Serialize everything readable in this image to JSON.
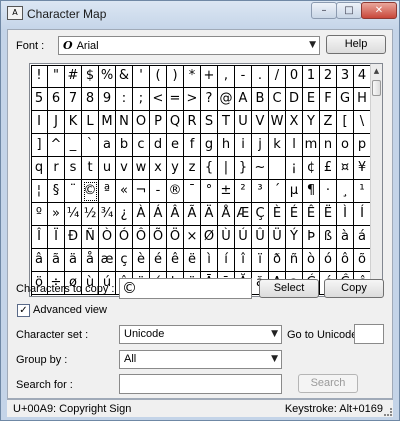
{
  "window": {
    "title": "Character Map",
    "controls": {
      "minimize": "–",
      "maximize": "□",
      "close": "✕"
    }
  },
  "font": {
    "label": "Font :",
    "value": "Arial",
    "font_glyph": "O",
    "help": "Help"
  },
  "grid": {
    "characters": [
      "!",
      "\"",
      "#",
      "$",
      "%",
      "&",
      "'",
      "(",
      ")",
      "*",
      "+",
      ",",
      "-",
      ".",
      "/",
      "0",
      "1",
      "2",
      "3",
      "4",
      "5",
      "6",
      "7",
      "8",
      "9",
      ":",
      ";",
      "<",
      "=",
      ">",
      "?",
      "@",
      "A",
      "B",
      "C",
      "D",
      "E",
      "F",
      "G",
      "H",
      "I",
      "J",
      "K",
      "L",
      "M",
      "N",
      "O",
      "P",
      "Q",
      "R",
      "S",
      "T",
      "U",
      "V",
      "W",
      "X",
      "Y",
      "Z",
      "[",
      "\\",
      "]",
      "^",
      "_",
      "`",
      "a",
      "b",
      "c",
      "d",
      "e",
      "f",
      "g",
      "h",
      "i",
      "j",
      "k",
      "l",
      "m",
      "n",
      "o",
      "p",
      "q",
      "r",
      "s",
      "t",
      "u",
      "v",
      "w",
      "x",
      "y",
      "z",
      "{",
      "|",
      "}",
      "~",
      " ",
      "¡",
      "¢",
      "£",
      "¤",
      "¥",
      "¦",
      "§",
      "¨",
      "©",
      "ª",
      "«",
      "¬",
      "-",
      "®",
      "¯",
      "°",
      "±",
      "²",
      "³",
      "´",
      "µ",
      "¶",
      "·",
      "¸",
      "¹",
      "º",
      "»",
      "¼",
      "½",
      "¾",
      "¿",
      "À",
      "Á",
      "Â",
      "Ã",
      "Ä",
      "Å",
      "Æ",
      "Ç",
      "È",
      "É",
      "Ê",
      "Ë",
      "Ì",
      "Í",
      "Î",
      "Ï",
      "Ð",
      "Ñ",
      "Ò",
      "Ó",
      "Ô",
      "Õ",
      "Ö",
      "×",
      "Ø",
      "Ù",
      "Ú",
      "Û",
      "Ü",
      "Ý",
      "Þ",
      "ß",
      "à",
      "á",
      "â",
      "ã",
      "ä",
      "å",
      "æ",
      "ç",
      "è",
      "é",
      "ê",
      "ë",
      "ì",
      "í",
      "î",
      "ï",
      "ð",
      "ñ",
      "ò",
      "ó",
      "ô",
      "õ",
      "ö",
      "÷",
      "ø",
      "ù",
      "ú",
      "û",
      "ü",
      "ý",
      "þ",
      "ÿ",
      "Ā",
      "ā",
      "Ă",
      "ă",
      "Ą",
      "ą",
      "Ć",
      "ć",
      "Ĉ",
      "ĉ"
    ],
    "selected_character": "©"
  },
  "copy": {
    "label": "Characters to copy :",
    "value": "©",
    "select": "Select",
    "copy": "Copy"
  },
  "advanced": {
    "label": "Advanced view",
    "checked_mark": "✓"
  },
  "charset": {
    "label": "Character set :",
    "value": "Unicode",
    "goto_label": "Go to Unicode :"
  },
  "groupby": {
    "label": "Group by :",
    "value": "All"
  },
  "search": {
    "label": "Search for :",
    "button": "Search"
  },
  "status": {
    "left": "U+00A9: Copyright Sign",
    "right": "Keystroke: Alt+0169"
  }
}
